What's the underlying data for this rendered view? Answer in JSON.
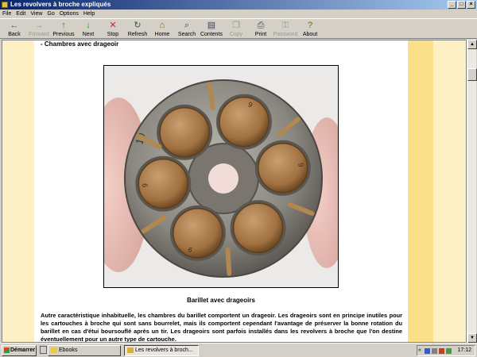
{
  "window": {
    "title": "Les revolvers à broche expliqués",
    "minimize": "_",
    "maximize": "□",
    "close": "×"
  },
  "menu": [
    "File",
    "Edit",
    "View",
    "Go",
    "Options",
    "Help"
  ],
  "toolbar": [
    {
      "label": "Back",
      "icon": "←",
      "color": "#208020",
      "enabled": true
    },
    {
      "label": "Forward",
      "icon": "→",
      "color": "#9a978f",
      "enabled": false
    },
    {
      "label": "Previous",
      "icon": "↑",
      "color": "#10a010",
      "enabled": true
    },
    {
      "label": "Next",
      "icon": "↓",
      "color": "#10a010",
      "enabled": true
    },
    {
      "label": "Stop",
      "icon": "✕",
      "color": "#d02020",
      "enabled": true
    },
    {
      "label": "Refresh",
      "icon": "↻",
      "color": "#306030",
      "enabled": true
    },
    {
      "label": "Home",
      "icon": "⌂",
      "color": "#806020",
      "enabled": true
    },
    {
      "label": "Search",
      "icon": "⌕",
      "color": "#404060",
      "enabled": true
    },
    {
      "label": "Contents",
      "icon": "▤",
      "color": "#404060",
      "enabled": true
    },
    {
      "label": "Copy",
      "icon": "❐",
      "color": "#9a978f",
      "enabled": false
    },
    {
      "label": "Print",
      "icon": "⎙",
      "color": "#404040",
      "enabled": true
    },
    {
      "label": "Password",
      "icon": "⚿",
      "color": "#9a978f",
      "enabled": false
    },
    {
      "label": "About",
      "icon": "?",
      "color": "#806000",
      "enabled": true
    }
  ],
  "page": {
    "section_title": "- Chambres avec drageoir",
    "caption": "Barillet avec drageoirs",
    "paragraph": "Autre caractéristique inhabituelle, les chambres du barillet comportent un drageoir. Les drageoirs sont en principe inutiles pour les cartouches à broche qui sont sans bourrelet, mais ils comportent cependant l'avantage de préserver la bonne rotation du barillet en cas d'étui boursouflé après un tir. Les drageoirs sont parfois installés dans les revolvers à broche que l'on destine éventuellement pour un autre type de cartouche."
  },
  "photo": {
    "cylinder_mark": "10",
    "headstamps": [
      "9",
      "9",
      "9",
      "9"
    ]
  },
  "taskbar": {
    "start_label": "Démarrer",
    "tasks": [
      {
        "label": "Ebooks",
        "active": false
      },
      {
        "label": "Les revolvers à broch...",
        "active": true
      }
    ],
    "tray_arrow": "«",
    "clock": "17:12"
  },
  "colors": {
    "page_bg": "#ffffff",
    "side_bg": "#fdf0c4",
    "stripe": "#fbe08a",
    "brass": "#a87a44"
  }
}
